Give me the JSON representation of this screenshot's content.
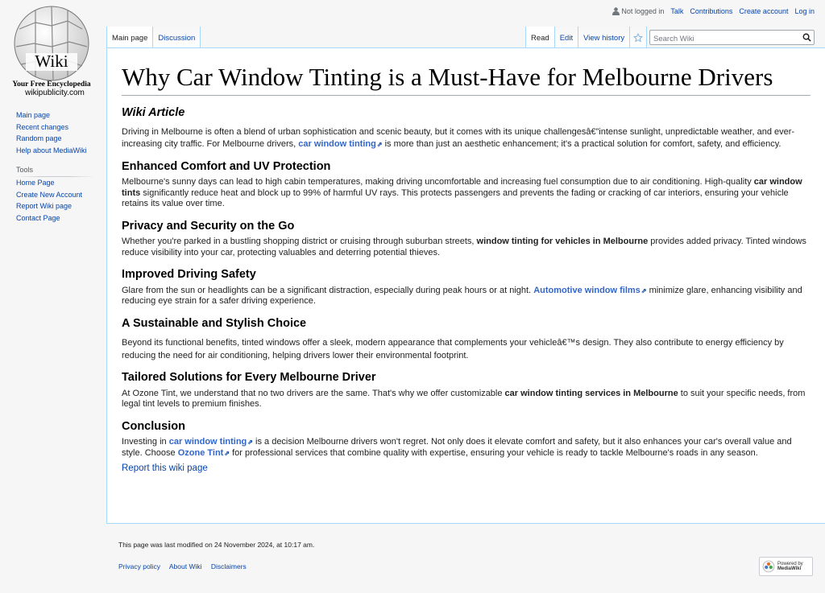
{
  "logo": {
    "title": "Wiki",
    "tagline": "Your Free Encyclopedia",
    "domain": "wikipublicity.com"
  },
  "personal_tools": {
    "status": "Not logged in",
    "items": [
      "Talk",
      "Contributions",
      "Create account",
      "Log in"
    ]
  },
  "tabs": {
    "left": [
      "Main page",
      "Discussion"
    ],
    "right": [
      "Read",
      "Edit",
      "View history"
    ]
  },
  "search": {
    "placeholder": "Search Wiki"
  },
  "sidebar": {
    "navigation": [
      "Main page",
      "Recent changes",
      "Random page",
      "Help about MediaWiki"
    ],
    "tools_heading": "Tools",
    "tools": [
      "Home Page",
      "Create New Account",
      "Report Wiki page",
      "Contact Page"
    ]
  },
  "article": {
    "title": "Why Car Window Tinting is a Must-Have for Melbourne Drivers",
    "label": "Wiki Article",
    "intro": {
      "t1": "Driving in Melbourne is often a blend of urban sophistication and scenic beauty, but it comes with its unique challengesâ€”intense sunlight, unpredictable weather, and ever-increasing city traffic. For Melbourne drivers, ",
      "link": "car window tinting",
      "t2": " is more than just an aesthetic enhancement; it's a practical solution for comfort, safety, and efficiency."
    },
    "s1": {
      "heading": "Enhanced Comfort and UV Protection",
      "t1": "Melbourne's sunny days can lead to high cabin temperatures, making driving uncomfortable and increasing fuel consumption due to air conditioning. High-quality ",
      "bold": "car window tints",
      "t2": " significantly reduce heat and block up to 99% of harmful UV rays. This protects passengers and prevents the fading or cracking of car interiors, ensuring your vehicle retains its value over time."
    },
    "s2": {
      "heading": "Privacy and Security on the Go",
      "t1": "Whether you're parked in a bustling shopping district or cruising through suburban streets, ",
      "bold": "window tinting for vehicles in Melbourne",
      "t2": " provides added privacy. Tinted windows reduce visibility into your car, protecting valuables and deterring potential thieves."
    },
    "s3": {
      "heading": "Improved Driving Safety",
      "t1": "Glare from the sun or headlights can be a significant distraction, especially during peak hours or at night. ",
      "link": "Automotive window films",
      "t2": " minimize glare, enhancing visibility and reducing eye strain for a safer driving experience."
    },
    "s4": {
      "heading": "A Sustainable and Stylish Choice",
      "text": "Beyond its functional benefits, tinted windows offer a sleek, modern appearance that complements your vehicleâ€™s design. They also contribute to energy efficiency by reducing the need for air conditioning, helping drivers lower their environmental footprint."
    },
    "s5": {
      "heading": "Tailored Solutions for Every Melbourne Driver",
      "t1": "At Ozone Tint, we understand that no two drivers are the same. That's why we offer customizable ",
      "bold": "car window tinting services in Melbourne",
      "t2": " to suit your specific needs, from legal tint levels to premium finishes."
    },
    "s6": {
      "heading": "Conclusion",
      "t1": "Investing in ",
      "link1": "car window tinting",
      "t2": " is a decision Melbourne drivers won't regret. Not only does it elevate comfort and safety, but it also enhances your car's overall value and style. Choose ",
      "link2": "Ozone Tint",
      "t3": " for professional services that combine quality with expertise, ensuring your vehicle is ready to tackle Melbourne's roads in any season."
    },
    "report_link": "Report this wiki page"
  },
  "footer": {
    "last_modified": "This page was last modified on 24 November 2024, at 10:17 am.",
    "links": [
      "Privacy policy",
      "About Wiki",
      "Disclaimers"
    ],
    "powered_line1": "Powered by",
    "powered_line2": "MediaWiki"
  }
}
